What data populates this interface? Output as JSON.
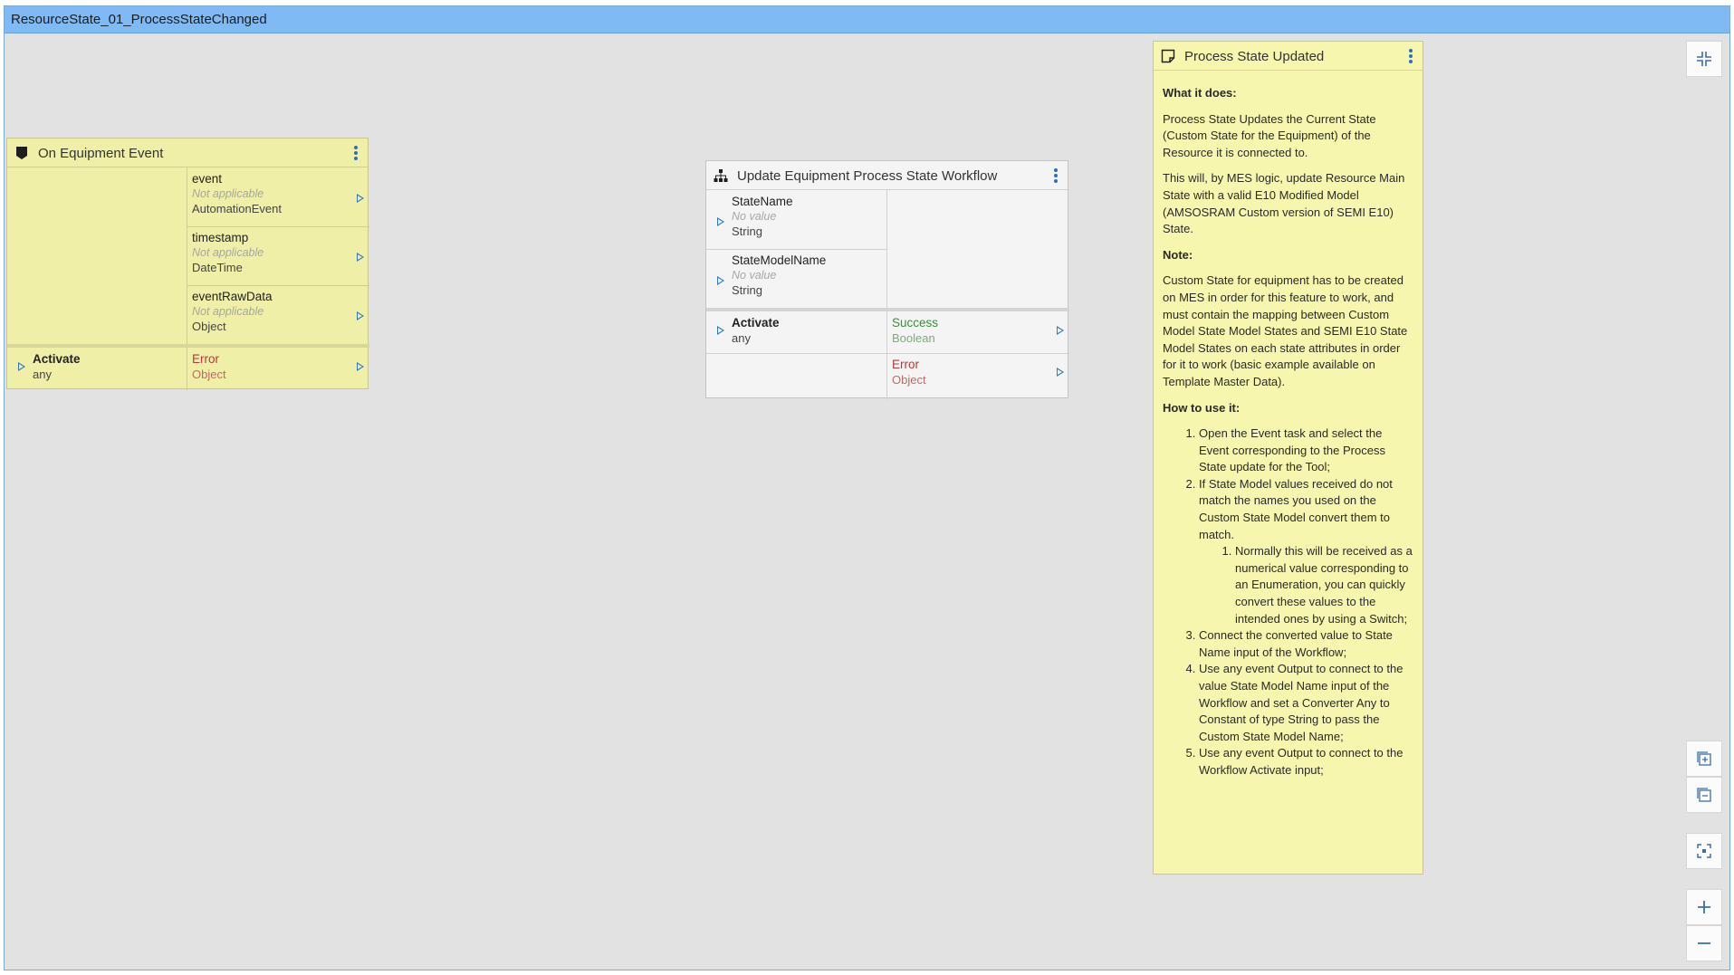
{
  "window": {
    "title": "ResourceState_01_ProcessStateChanged"
  },
  "equipment_event": {
    "title": "On Equipment Event",
    "outputs": [
      {
        "name": "event",
        "value": "Not applicable",
        "type": "AutomationEvent"
      },
      {
        "name": "timestamp",
        "value": "Not applicable",
        "type": "DateTime"
      },
      {
        "name": "eventRawData",
        "value": "Not applicable",
        "type": "Object"
      }
    ],
    "activate": {
      "name": "Activate",
      "type": "any"
    },
    "error": {
      "name": "Error",
      "type": "Object"
    }
  },
  "workflow": {
    "title": "Update Equipment Process State Workflow",
    "inputs": [
      {
        "name": "StateName",
        "value": "No value",
        "type": "String"
      },
      {
        "name": "StateModelName",
        "value": "No value",
        "type": "String"
      }
    ],
    "activate": {
      "name": "Activate",
      "type": "any"
    },
    "success": {
      "name": "Success",
      "type": "Boolean"
    },
    "error": {
      "name": "Error",
      "type": "Object"
    }
  },
  "note": {
    "title": "Process State Updated",
    "what_heading": "What it does:",
    "para1": "Process State Updates the Current State (Custom State for the Equipment) of the Resource it is connected to.",
    "para2": "This will, by MES logic, update Resource Main State with a valid E10 Modified Model (AMSOSRAM Custom version of SEMI E10) State.",
    "note_heading": "Note:",
    "para3": "Custom State for equipment has to be created on MES in order for this feature to work, and must contain the mapping between Custom Model State Model States and SEMI E10 State Model States on each state attributes in order for it to work (basic example available on Template Master Data).",
    "how_heading": "How to use it:",
    "steps": [
      "Open the Event task and select the Event corresponding to the Process State update for the Tool;",
      "If State Model values received do not match the names you used on the Custom State Model convert them to match.",
      "Connect the converted value to State Name input of the Workflow;",
      "Use any event Output to connect to the value State Model Name input of the Workflow and set a Converter Any to Constant of type String to pass the Custom State Model Name;",
      "Use any event Output to connect to the Workflow Activate input;"
    ],
    "substep": "Normally this will be received as a numerical value corresponding to an Enumeration, you can quickly convert these values to the intended ones by using a Switch;"
  },
  "colors": {
    "titlebar": "#7fbaf4",
    "node": "#efefa8",
    "note": "#f6f6ae",
    "port_arrow": "#2f78c4",
    "error": "#b23b3b",
    "success": "#3e8a3e"
  },
  "toolbar": [
    "collapse-icon",
    "expand-all-icon",
    "collapse-all-icon",
    "fit-to-screen-icon",
    "zoom-in-icon",
    "zoom-out-icon"
  ]
}
